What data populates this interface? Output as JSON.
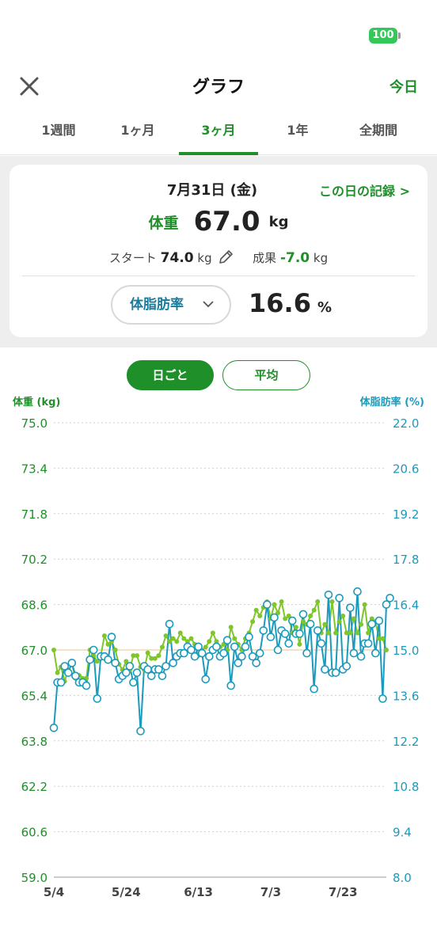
{
  "status": {
    "battery": "100"
  },
  "nav": {
    "title": "グラフ",
    "today": "今日"
  },
  "tabs": [
    "1週間",
    "1ヶ月",
    "3ヶ月",
    "1年",
    "全期間"
  ],
  "active_tab": "3ヶ月",
  "summary": {
    "date": "7月31日 (金)",
    "day_record": "この日の記録 >",
    "weight_label": "体重",
    "weight_value": "67.0",
    "weight_unit": "kg",
    "start_label": "スタート",
    "start_value": "74.0",
    "start_unit": "kg",
    "result_label": "成果",
    "result_value": "-7.0",
    "result_unit": "kg",
    "fat_select": "体脂肪率",
    "fat_value": "16.6",
    "fat_unit": "%"
  },
  "toggles": {
    "daily": "日ごと",
    "average": "平均"
  },
  "colors": {
    "weight": "#7ec62a",
    "fat": "#1a9bbd",
    "accent": "#1f8f2a",
    "goal_line": "#f0d9b5"
  },
  "chart_data": {
    "type": "line",
    "ylabel_left": "体重 (kg)",
    "ylabel_right": "体脂肪率 (%)",
    "ylim_left": [
      59.0,
      75.0
    ],
    "ylim_right": [
      8.0,
      22.0
    ],
    "yticks_left": [
      "75.0",
      "73.4",
      "71.8",
      "70.2",
      "68.6",
      "67.0",
      "65.4",
      "63.8",
      "62.2",
      "60.6",
      "59.0"
    ],
    "yticks_right": [
      "22.0",
      "20.6",
      "19.2",
      "17.8",
      "16.4",
      "15.0",
      "13.6",
      "12.2",
      "10.8",
      "9.4",
      "8.0"
    ],
    "xticks": [
      "5/4",
      "5/24",
      "6/13",
      "7/3",
      "7/23"
    ],
    "x_start": "5/4",
    "x_end": "7/31",
    "reference_line_kg": 67.0,
    "series": [
      {
        "values": [
          67.0,
          66.2,
          66.4,
          65.9,
          66.3,
          66.5,
          66.0,
          66.1,
          66.0,
          66.0,
          67.0,
          66.8,
          66.6,
          66.8,
          67.5,
          67.2,
          67.3,
          67.0,
          66.5,
          66.3,
          66.6,
          66.3,
          66.8,
          66.8,
          66.4,
          66.3,
          66.9,
          66.7,
          66.7,
          66.8,
          67.1,
          67.5,
          67.3,
          67.4,
          67.3,
          67.6,
          67.4,
          67.3,
          67.4,
          67.2,
          66.8,
          67.0,
          67.1,
          67.3,
          67.6,
          67.3,
          67.1,
          67.2,
          67.0,
          67.8,
          67.4,
          67.2,
          67.0,
          67.4,
          67.6,
          68.0,
          68.4,
          68.2,
          68.5,
          68.7,
          68.1,
          68.6,
          68.3,
          68.7,
          68.1,
          68.2,
          67.6,
          67.8,
          67.2,
          68.0,
          67.9,
          68.2,
          68.4,
          68.7,
          67.6,
          67.9,
          67.6,
          68.7,
          67.6,
          68.0,
          68.2,
          67.6,
          67.6,
          68.1,
          67.6,
          67.9,
          68.6,
          67.6,
          68.1,
          68.0,
          67.4,
          67.4,
          67.0
        ]
      },
      {
        "values": [
          12.6,
          14.0,
          14.0,
          14.5,
          14.3,
          14.6,
          14.2,
          14.0,
          14.0,
          13.9,
          14.7,
          15.0,
          13.5,
          14.8,
          14.8,
          14.7,
          15.4,
          14.6,
          14.1,
          14.2,
          14.3,
          14.5,
          14.0,
          14.3,
          12.5,
          14.5,
          14.4,
          14.2,
          14.4,
          14.4,
          14.2,
          14.5,
          15.8,
          14.6,
          14.8,
          14.9,
          14.9,
          15.1,
          15.0,
          14.8,
          15.1,
          14.9,
          14.1,
          14.8,
          15.0,
          15.1,
          14.8,
          14.9,
          15.3,
          13.9,
          15.1,
          14.6,
          14.8,
          15.1,
          15.4,
          14.8,
          14.6,
          14.9,
          15.6,
          16.4,
          15.4,
          16.0,
          15.0,
          15.6,
          15.5,
          15.2,
          15.9,
          15.5,
          15.5,
          16.1,
          14.9,
          15.8,
          13.8,
          15.6,
          15.2,
          14.4,
          16.7,
          14.3,
          14.3,
          16.6,
          14.4,
          14.5,
          16.3,
          14.9,
          16.8,
          14.8,
          15.2,
          15.2,
          15.8,
          14.9,
          15.9,
          13.5,
          16.4,
          16.6
        ]
      }
    ]
  }
}
